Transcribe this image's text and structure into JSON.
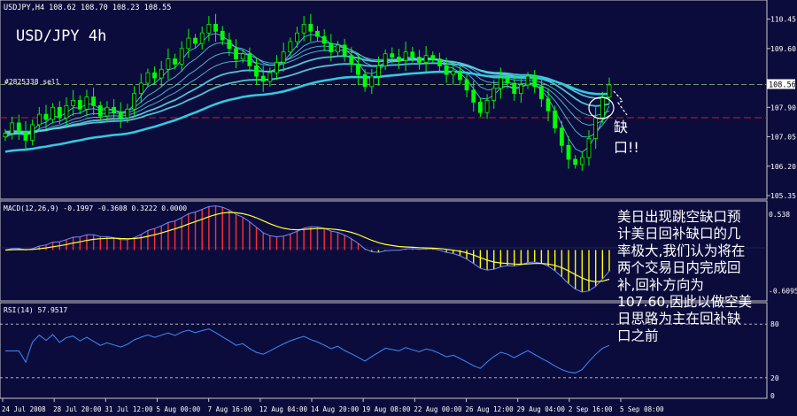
{
  "header": {
    "symbol_info": "USDJPY,H4  108.62 108.70 108.23 108.55",
    "big_title": "USD/JPY 4h",
    "order_label": "#2825338 sell"
  },
  "annotations": {
    "gap_label": "缺口!!",
    "commentary": [
      "美日出现跳空缺口预",
      "计美日回补缺口的几",
      "率极大,我们认为将在",
      "两个交易日内完成回",
      "补,回补方向为",
      "107.60,因此以做空美",
      "日思路为主在回补缺",
      "口之前"
    ]
  },
  "colors": {
    "background": "#0c0c3c",
    "candle": "#00ff00",
    "ema_band": "#5bd3e3",
    "ema_slow": "#36c7e0",
    "sell_line": "#7a9a6a",
    "target_line": "#c02020",
    "macd_signal": "#ffff40",
    "macd_line": "#6f8bff",
    "macd_hist_up": "#ff3030",
    "macd_hist_down": "#ffff00",
    "rsi_line": "#3a8cff"
  },
  "chart_data": [
    {
      "type": "candlestick",
      "panel": "price",
      "yticks": [
        "110.45",
        "109.60",
        "108.56",
        "107.90",
        "107.05",
        "106.20",
        "105.35"
      ],
      "ylim": [
        105.35,
        110.9
      ],
      "sell_level": 108.56,
      "target_level": 107.6,
      "xticks": [
        "24 Jul 2008",
        "28 Jul 20:00",
        "31 Jul 12:00",
        "5 Aug 00:00",
        "7 Aug 16:00",
        "12 Aug 04:00",
        "14 Aug 20:00",
        "19 Aug 08:00",
        "22 Aug 00:00",
        "26 Aug 12:00",
        "29 Aug 04:00",
        "2 Sep 16:00",
        "5 Sep 08:00"
      ],
      "close": [
        107.15,
        107.45,
        107.2,
        106.95,
        107.4,
        107.7,
        107.55,
        107.9,
        107.6,
        107.95,
        108.1,
        107.85,
        108.2,
        107.95,
        107.65,
        107.9,
        107.75,
        107.6,
        107.85,
        108.3,
        108.6,
        108.9,
        108.75,
        109.0,
        109.3,
        109.15,
        109.6,
        109.9,
        109.75,
        110.05,
        110.3,
        110.1,
        109.85,
        109.6,
        109.3,
        109.45,
        109.1,
        108.8,
        108.65,
        108.9,
        109.2,
        109.5,
        109.8,
        110.05,
        110.3,
        110.1,
        109.95,
        109.75,
        109.5,
        109.7,
        109.4,
        109.15,
        108.85,
        108.5,
        108.8,
        109.1,
        109.45,
        109.35,
        109.25,
        109.5,
        109.35,
        109.2,
        109.4,
        109.3,
        109.1,
        108.85,
        108.95,
        108.7,
        108.4,
        108.05,
        107.75,
        108.1,
        108.45,
        108.75,
        108.6,
        108.3,
        108.55,
        108.8,
        108.5,
        108.15,
        107.8,
        107.3,
        106.8,
        106.4,
        106.25,
        106.45,
        107.0,
        107.6,
        108.2,
        108.55
      ],
      "ema_band_start": [
        107.0,
        107.0,
        107.05,
        107.1,
        107.15,
        107.2
      ],
      "ema_band_alpha": [
        0.4,
        0.22,
        0.14,
        0.1,
        0.07,
        0.05
      ],
      "ema_slow_start": 106.6,
      "ema_slow_alpha": 0.035
    },
    {
      "type": "macd",
      "panel": "macd",
      "title": "MACD(12,26,9) -0.1997 -0.3608 0.3222 0.0000",
      "yticks": [
        "0.538",
        "-0.6095"
      ],
      "ylim": [
        -0.72,
        0.68
      ],
      "fast": 12,
      "slow": 26,
      "signal": 9
    },
    {
      "type": "line",
      "panel": "rsi",
      "title": "RSI(14) 57.9517",
      "yticks": [
        "80",
        "20",
        "0"
      ],
      "ylim": [
        0,
        100
      ],
      "levels": [
        80,
        20
      ],
      "period": 14
    }
  ]
}
